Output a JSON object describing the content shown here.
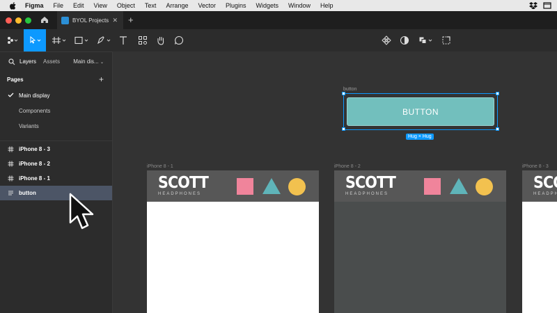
{
  "menubar": {
    "app": "Figma",
    "items": [
      "File",
      "Edit",
      "View",
      "Object",
      "Text",
      "Arrange",
      "Vector",
      "Plugins",
      "Widgets",
      "Window",
      "Help"
    ]
  },
  "tabbar": {
    "file_tab": "BYOL Projects",
    "close": "✕",
    "new_tab": "+"
  },
  "left_panel": {
    "tabs": {
      "layers": "Layers",
      "assets": "Assets",
      "page_selector": "Main dis..."
    },
    "pages_title": "Pages",
    "pages": [
      {
        "label": "Main display",
        "selected": true
      },
      {
        "label": "Components",
        "selected": false
      },
      {
        "label": "Variants",
        "selected": false
      }
    ],
    "layers": [
      {
        "label": "iPhone 8 - 3",
        "icon": "frame-icon"
      },
      {
        "label": "iPhone 8 - 2",
        "icon": "frame-icon"
      },
      {
        "label": "iPhone 8 - 1",
        "icon": "frame-icon"
      },
      {
        "label": "button",
        "icon": "auto-layout-icon",
        "selected": true
      }
    ]
  },
  "canvas": {
    "button_frame_label": "button",
    "button_text": "BUTTON",
    "hug_label": "Hug × Hug",
    "frames": [
      {
        "label": "iPhone 8 - 1",
        "body_color": "#ffffff"
      },
      {
        "label": "iPhone 8 - 2",
        "body_color": "#4a4d4d"
      },
      {
        "label": "iPhone 8 - 3",
        "body_color": "#ffffff"
      }
    ],
    "logo_big": "SCOTT",
    "logo_small": "HEADPHONES"
  },
  "colors": {
    "accent": "#0d99ff",
    "button_fill": "#72bfbd",
    "square": "#f0849b",
    "triangle": "#5fb4b9",
    "circle": "#f2c14f"
  }
}
